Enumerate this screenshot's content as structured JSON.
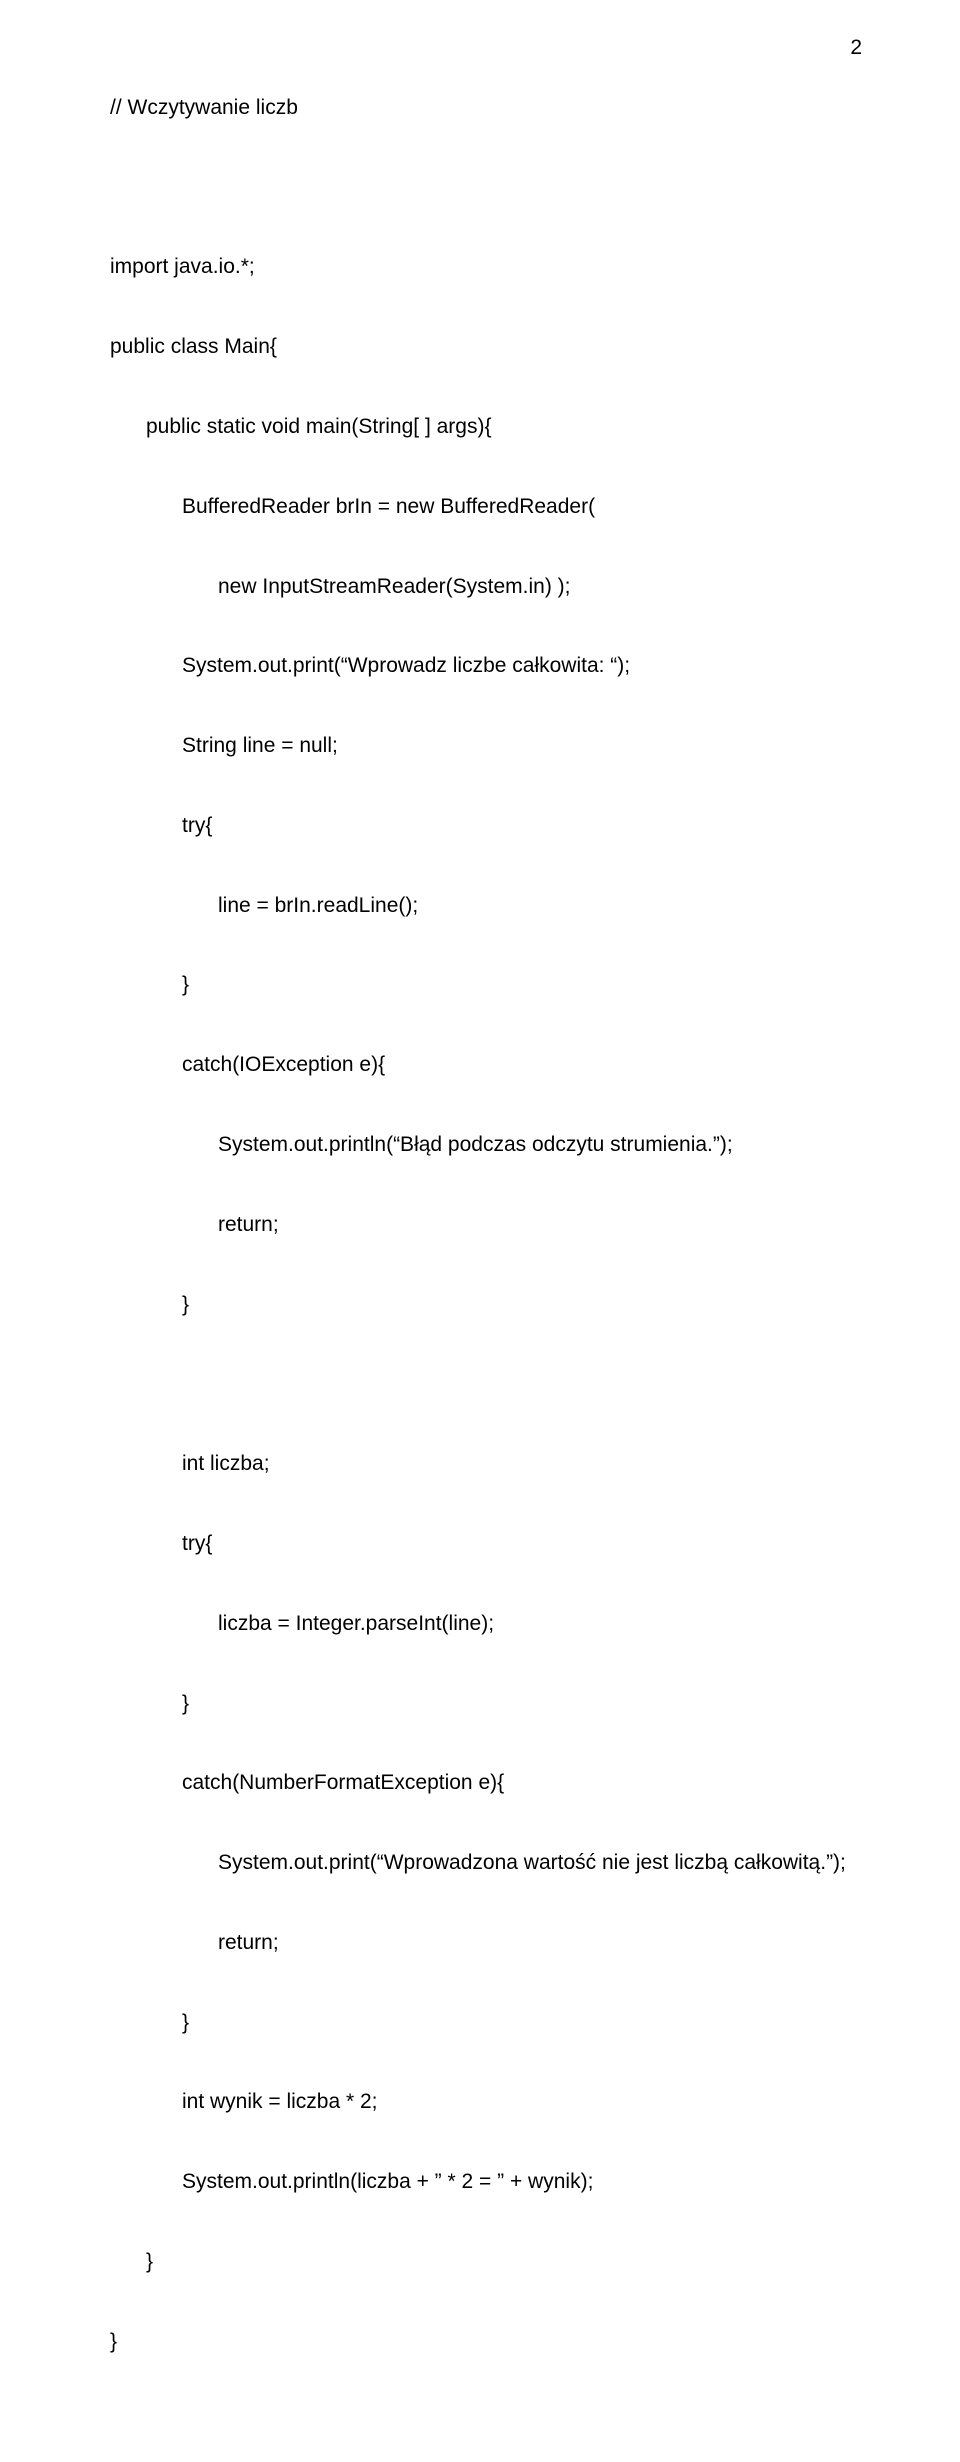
{
  "pageNumber": "2",
  "lines": {
    "l1": "// Wczytywanie liczb",
    "l2": "import java.io.*;",
    "l3": "public class Main{",
    "l4": "public static void main(String[ ] args){",
    "l5": "BufferedReader brIn = new BufferedReader(",
    "l6": "new InputStreamReader(System.in) );",
    "l7": "System.out.print(“Wprowadz liczbe całkowita: “);",
    "l8": "String line = null;",
    "l9": "try{",
    "l10": "line = brIn.readLine();",
    "l11": "}",
    "l12": "catch(IOException e){",
    "l13": "System.out.println(“Błąd podczas odczytu strumienia.”);",
    "l14": "return;",
    "l15": "}",
    "l16": "int liczba;",
    "l17": "try{",
    "l18": "liczba = Integer.parseInt(line);",
    "l19": "}",
    "l20": "catch(NumberFormatException e){",
    "l21": "System.out.print(“Wprowadzona wartość nie jest liczbą całkowitą.”);",
    "l22": "return;",
    "l23": "}",
    "l24": "int wynik = liczba * 2;",
    "l25": "System.out.println(liczba + ” * 2 = ” + wynik);",
    "l26": "}",
    "l27": "}"
  }
}
